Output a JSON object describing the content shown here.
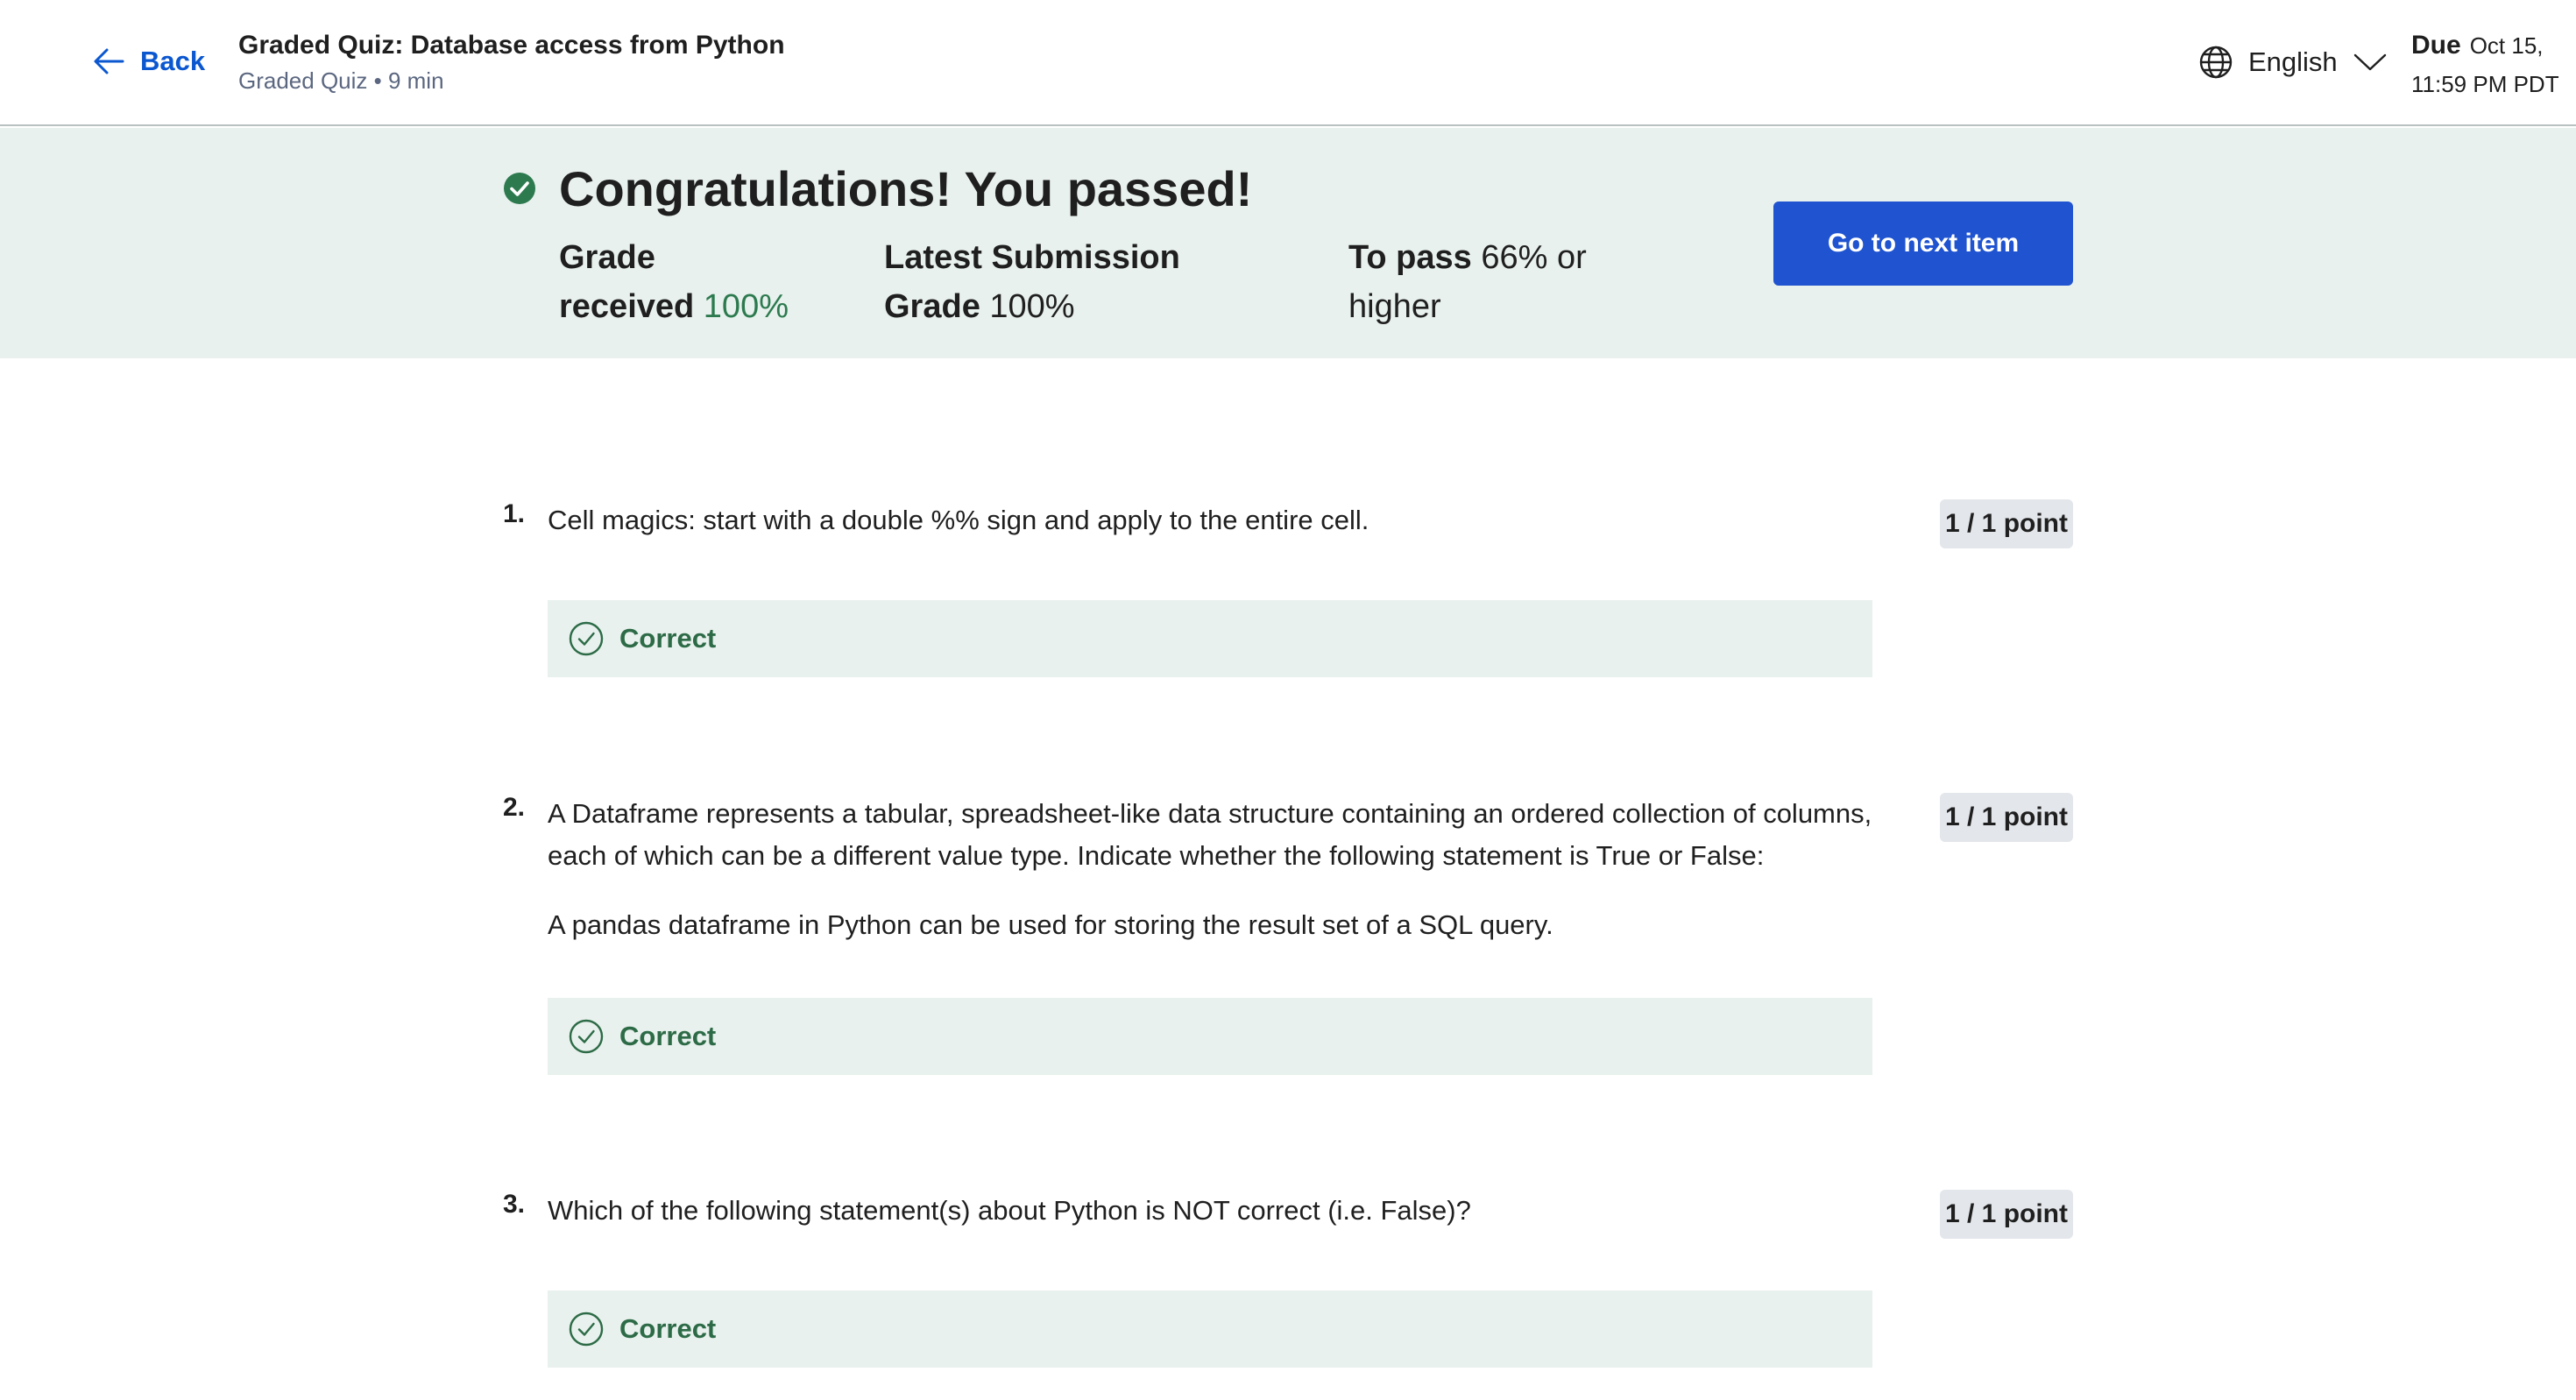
{
  "header": {
    "back_label": "Back",
    "title": "Graded Quiz: Database access from Python",
    "subtitle": "Graded Quiz • 9 min",
    "language": "English",
    "due_label": "Due",
    "due_date_line1": "Oct 15,",
    "due_date_line2": "11:59 PM PDT"
  },
  "banner": {
    "heading": "Congratulations! You passed!",
    "grade_label_1": "Grade",
    "grade_label_2": "received",
    "grade_value": "100%",
    "latest_label_1": "Latest Submission",
    "latest_label_2": "Grade",
    "latest_value": "100%",
    "pass_label": "To pass",
    "pass_value_1": "66% or",
    "pass_value_2": "higher",
    "next_button": "Go to next item"
  },
  "questions": [
    {
      "number": "1.",
      "text": "Cell magics: start with a double %% sign and apply to the entire cell.",
      "points": "1 / 1 point",
      "result": "Correct"
    },
    {
      "number": "2.",
      "text": "A Dataframe represents a tabular, spreadsheet-like data structure containing an ordered collection of columns, each of which can be a different value type. Indicate whether the following statement is True or False:",
      "text2": "A pandas dataframe in Python can be used for storing the result set of a SQL query.",
      "points": "1 / 1 point",
      "result": "Correct"
    },
    {
      "number": "3.",
      "text": "Which of the following statement(s) about Python is NOT correct (i.e. False)?",
      "points": "1 / 1 point",
      "result": "Correct"
    }
  ],
  "colors": {
    "accent": "#1f53d0",
    "success_bg": "#e8f1ed",
    "success_text": "#2d6b47"
  }
}
